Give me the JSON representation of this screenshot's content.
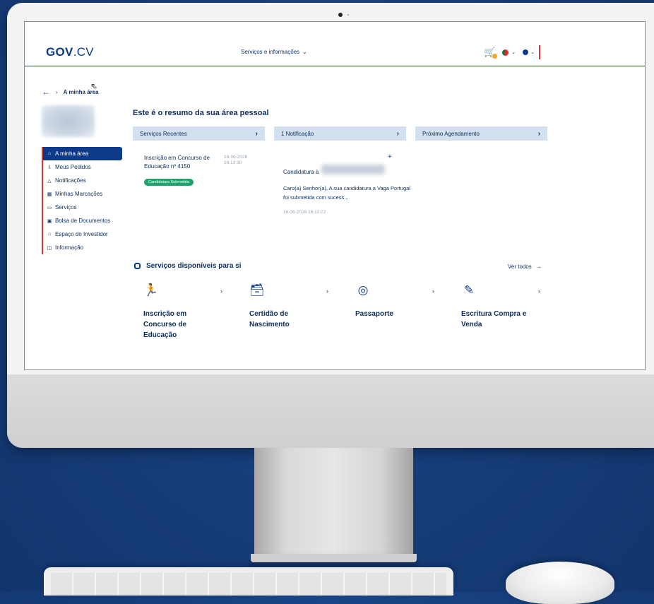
{
  "header": {
    "logo_bold": "GOV",
    "logo_light": ".CV",
    "nav_label": "Serviços e informações"
  },
  "breadcrumb": {
    "current": "A minha área"
  },
  "sidebar": {
    "items": [
      {
        "label": "A minha área",
        "icon": "home-icon"
      },
      {
        "label": "Meus Pedidos",
        "icon": "pin-icon"
      },
      {
        "label": "Notificações",
        "icon": "bell-icon"
      },
      {
        "label": "Minhas Marcações",
        "icon": "calendar-icon"
      },
      {
        "label": "Serviços",
        "icon": "folder-icon"
      },
      {
        "label": "Bolsa de Documentos",
        "icon": "id-card-icon"
      },
      {
        "label": "Espaço do Investidor",
        "icon": "bank-icon"
      },
      {
        "label": "Informação",
        "icon": "info-icon"
      }
    ]
  },
  "summary": {
    "title": "Este é o resumo da sua área pessoal",
    "panels": [
      {
        "label": "Serviços Recentes"
      },
      {
        "label": "1 Notificação"
      },
      {
        "label": "Próximo Agendamento"
      }
    ],
    "recent": {
      "name": "Inscrição em Concurso de Educação nº 4150",
      "date": "16-06-2026",
      "time": "16:13:30",
      "status": "Candidatura Submetida"
    },
    "notification": {
      "title": "Candidatura à",
      "body": "Caro(a) Senhor(a), A sua candidatura a Vaga Portugal foi submetida com sucess...",
      "date": "16-06-2026 16:13:22"
    }
  },
  "services": {
    "title": "Serviços disponíveis para si",
    "see_all": "Ver todos",
    "items": [
      {
        "name": "Inscrição em Concurso de Educação",
        "icon": "person-running-icon"
      },
      {
        "name": "Certidão de Nascimento",
        "icon": "inbox-icon"
      },
      {
        "name": "Passaporte",
        "icon": "fingerprint-icon"
      },
      {
        "name": "Escritura Compra e Venda",
        "icon": "edit-document-icon"
      }
    ]
  },
  "colors": {
    "brand": "#0d3b8a",
    "accent_red": "#e03131",
    "panel_bg": "#d3e0f0",
    "status_green": "#1fa36b",
    "background_blue": "#173f7d"
  }
}
